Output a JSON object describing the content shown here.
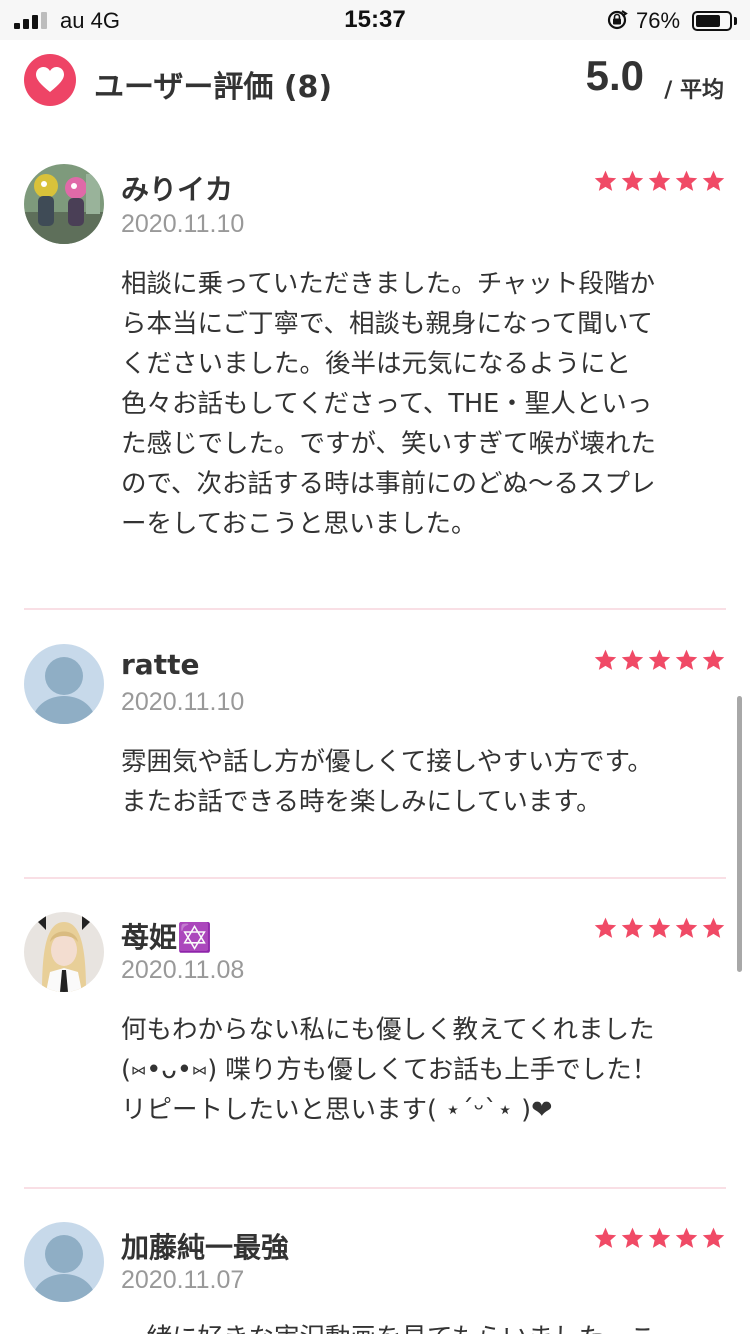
{
  "status_bar": {
    "carrier": "au  4G",
    "time": "15:37",
    "battery_percent": "76%",
    "battery_level": 0.76,
    "signal_bars_active": 3,
    "signal_bars_total": 4
  },
  "header": {
    "title": "ユーザー評価 (8)",
    "average_score": "5.0",
    "average_label": "/ 平均",
    "icon": "heart-icon",
    "accent_color": "#ee4466"
  },
  "star_color": "#f04a66",
  "reviews": [
    {
      "name": "みりイカ",
      "date": "2020.11.10",
      "rating": 5,
      "avatar": "photo",
      "lines": [
        "相談に乗っていただきました。チャット段階か",
        "ら本当にご丁寧で、相談も親身になって聞いて",
        "くださいました。後半は元気になるようにと",
        "色々お話もしてくださって、THE・聖人といっ",
        "た感じでした。ですが、笑いすぎて喉が壊れた",
        "ので、次お話する時は事前にのどぬ〜るスプレ",
        "ーをしておこうと思いました。"
      ]
    },
    {
      "name": "ratte",
      "date": "2020.11.10",
      "rating": 5,
      "avatar": "default",
      "lines": [
        "雰囲気や話し方が優しくて接しやすい方です。",
        "またお話できる時を楽しみにしています。"
      ]
    },
    {
      "name": "苺姫✡️",
      "date": "2020.11.08",
      "rating": 5,
      "avatar": "photo",
      "lines": [
        "何もわからない私にも優しく教えてくれました",
        "(⑅•ᴗ•⑅) 喋り方も優しくてお話も上手でした！",
        "リピートしたいと思います( ⋆ˊᵕˋ⋆ )❤"
      ]
    },
    {
      "name": "加藤純一最強",
      "date": "2020.11.07",
      "rating": 5,
      "avatar": "default",
      "lines": [
        "一緒に好きな実況動画を見てもらいました。こ"
      ]
    }
  ]
}
